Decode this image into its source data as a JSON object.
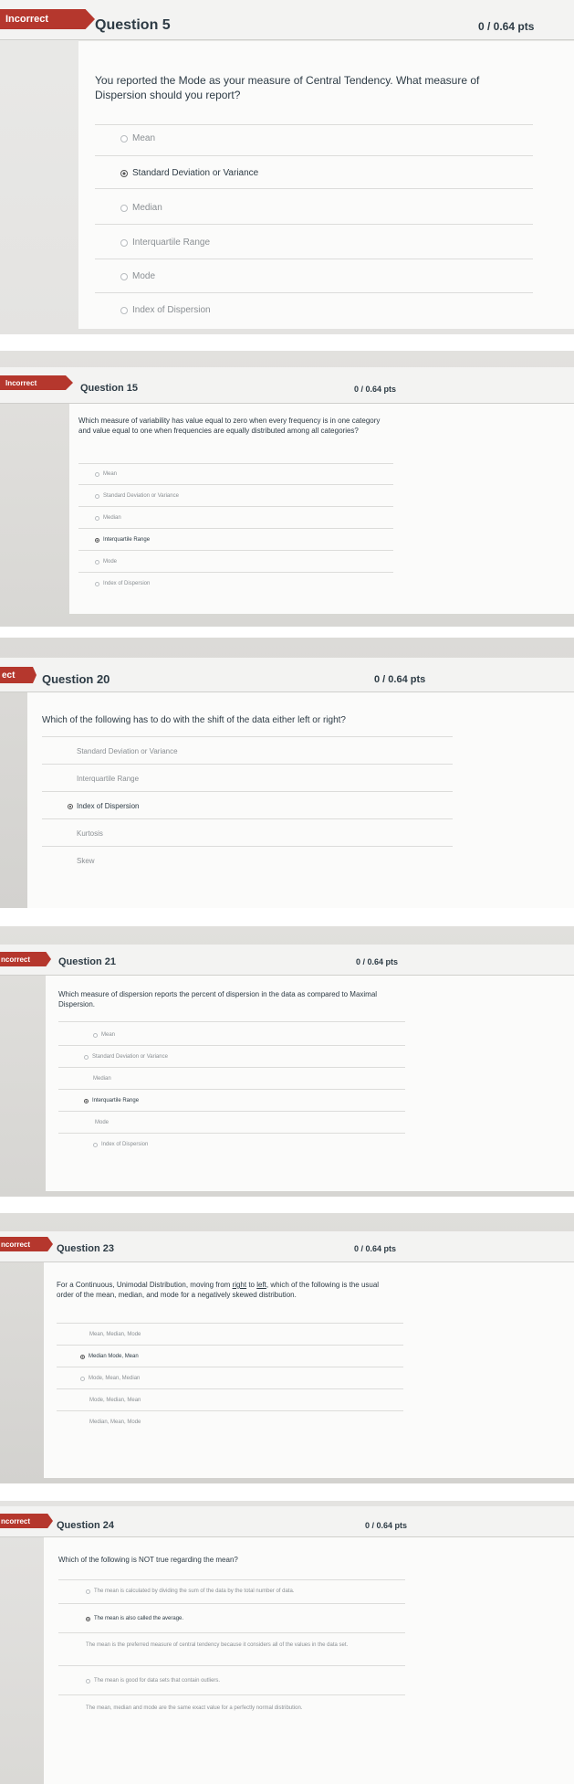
{
  "questions": [
    {
      "status": "Incorrect",
      "title": "Question 5",
      "points": "0 / 0.64 pts",
      "text": "You reported the Mode as your measure of Central Tendency. What measure of Dispersion should you report?",
      "options": [
        "Mean",
        "Standard Deviation or Variance",
        "Median",
        "Interquartile Range",
        "Mode",
        "Index of Dispersion"
      ],
      "selected": "Standard Deviation or Variance"
    },
    {
      "status": "Incorrect",
      "title": "Question 15",
      "points": "0 / 0.64 pts",
      "text": "Which measure of variability has value equal to zero when every frequency is in one category and value equal to one when frequencies are equally distributed among all categories?",
      "options": [
        "Mean",
        "Standard Deviation or Variance",
        "Median",
        "Interquartile Range",
        "Mode",
        "Index of Dispersion"
      ],
      "selected": "Interquartile Range"
    },
    {
      "status": "ect",
      "title": "Question 20",
      "points": "0 / 0.64 pts",
      "text": "Which of the following has to do with the shift of the data either left or right?",
      "options": [
        "Standard Deviation or Variance",
        "Interquartile Range",
        "Index of Dispersion",
        "Kurtosis",
        "Skew"
      ],
      "selected": "Index of Dispersion"
    },
    {
      "status": "ncorrect",
      "title": "Question 21",
      "points": "0 / 0.64 pts",
      "text": "Which measure of dispersion reports the percent of dispersion in the data as compared to Maximal Dispersion.",
      "options": [
        "Mean",
        "Standard Deviation or Variance",
        "Median",
        "Interquartile Range",
        "Mode",
        "Index of Dispersion"
      ],
      "selected": "Interquartile Range"
    },
    {
      "status": "ncorrect",
      "title": "Question 23",
      "points": "0 / 0.64 pts",
      "text_pre": "For a Continuous, Unimodal Distribution, moving from ",
      "text_right": "right",
      "text_mid": " to ",
      "text_left": "left",
      "text_post": ", which of the following is the usual order of the mean, median, and mode for a negatively skewed distribution.",
      "options": [
        "Mean, Median, Mode",
        "Median Mode, Mean",
        "Mode, Mean, Median",
        "Mode, Median, Mean",
        "Median, Mean, Mode"
      ],
      "selected": "Median Mode, Mean"
    },
    {
      "status": "ncorrect",
      "title": "Question 24",
      "points": "0 / 0.64 pts",
      "text": "Which of the following is NOT true regarding the mean?",
      "options": [
        "The mean is calculated by dividing the sum of the data by the total number of data.",
        "The mean is also called the average.",
        "The mean is the preferred measure of central tendency because it considers all of the values in the data set.",
        "The mean is good for data sets that contain outliers.",
        "The mean, median and mode are the same exact value for a perfectly normal distribution."
      ],
      "selected": "The mean is also called the average."
    }
  ]
}
